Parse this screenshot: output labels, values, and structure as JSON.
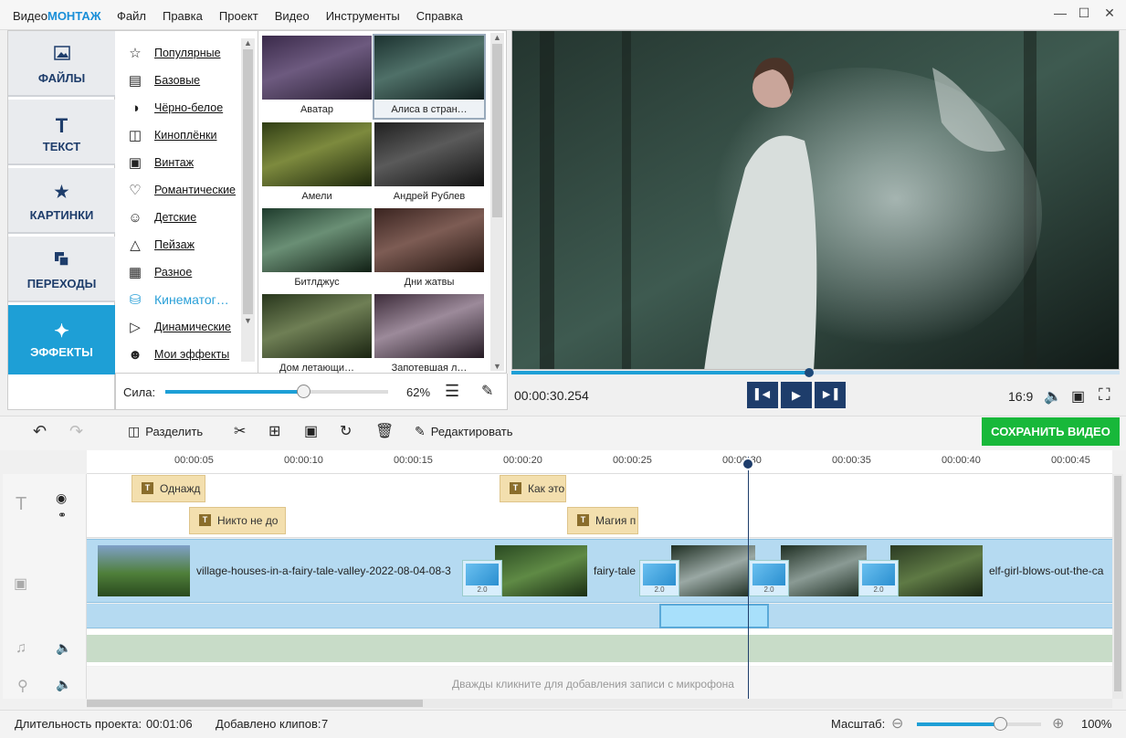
{
  "app": {
    "logo_prefix": "Видео",
    "logo_brand": "МОНТАЖ"
  },
  "menu": [
    "Файл",
    "Правка",
    "Проект",
    "Видео",
    "Инструменты",
    "Справка"
  ],
  "nav": [
    {
      "label": "ФАЙЛЫ",
      "icon": "image-icon",
      "active": false
    },
    {
      "label": "ТЕКСТ",
      "icon": "text-icon",
      "active": false
    },
    {
      "label": "КАРТИНКИ",
      "icon": "star-icon",
      "active": false
    },
    {
      "label": "ПЕРЕХОДЫ",
      "icon": "transitions-icon",
      "active": false
    },
    {
      "label": "ЭФФЕКТЫ",
      "icon": "magic-wand-icon",
      "active": true
    }
  ],
  "categories": [
    {
      "label": "Популярные",
      "icon": "star-icon"
    },
    {
      "label": "Базовые",
      "icon": "basic-icon"
    },
    {
      "label": "Чёрно-белое",
      "icon": "bw-icon"
    },
    {
      "label": "Киноплёнки",
      "icon": "film-icon"
    },
    {
      "label": "Винтаж",
      "icon": "camera-icon"
    },
    {
      "label": "Романтические",
      "icon": "heart-icon"
    },
    {
      "label": "Детские",
      "icon": "kids-icon"
    },
    {
      "label": "Пейзаж",
      "icon": "mountain-icon"
    },
    {
      "label": "Разное",
      "icon": "misc-icon"
    },
    {
      "label": "Кинематог…",
      "icon": "cinema-icon",
      "selected": true
    },
    {
      "label": "Динамические",
      "icon": "play-circle-icon"
    },
    {
      "label": "Мои эффекты",
      "icon": "user-icon"
    }
  ],
  "effects": [
    {
      "label": "Аватар",
      "selected": false
    },
    {
      "label": "Алиса в стран…",
      "selected": true
    },
    {
      "label": "Амели",
      "selected": false
    },
    {
      "label": "Андрей Рублев",
      "selected": false
    },
    {
      "label": "Битлджус",
      "selected": false
    },
    {
      "label": "Дни жатвы",
      "selected": false
    },
    {
      "label": "Дом летающи…",
      "selected": false
    },
    {
      "label": "Запотевшая л…",
      "selected": false
    }
  ],
  "strength": {
    "label": "Сила:",
    "value": 62,
    "text": "62%"
  },
  "player": {
    "timecode": "00:00:30.254",
    "aspect": "16:9",
    "progress": 0.49
  },
  "toolbar": {
    "split": "Разделить",
    "edit": "Редактировать",
    "save": "СОХРАНИТЬ ВИДЕО"
  },
  "ruler": [
    "00:00:05",
    "00:00:10",
    "00:00:15",
    "00:00:20",
    "00:00:25",
    "00:00:30",
    "00:00:35",
    "00:00:40",
    "00:00:45"
  ],
  "text_clips": [
    "Однажд",
    "Никто не до",
    "Как это",
    "Магия п"
  ],
  "video_clips": [
    "village-houses-in-a-fairy-tale-valley-2022-08-04-08-3",
    "fairy-tale",
    "elf-girl-blows-out-the-ca"
  ],
  "transition_value": "2.0",
  "mic_hint": "Дважды кликните для добавления записи с микрофона",
  "status": {
    "duration_label": "Длительность проекта:",
    "duration": "00:01:06",
    "clips_label": "Добавлено клипов:",
    "clips": "7",
    "scale_label": "Масштаб:",
    "scale": "100%"
  },
  "colors": {
    "accent": "#1e9fd6",
    "save": "#18b83a",
    "text_clip": "#f3dfae",
    "video_track": "#b5daf1"
  }
}
